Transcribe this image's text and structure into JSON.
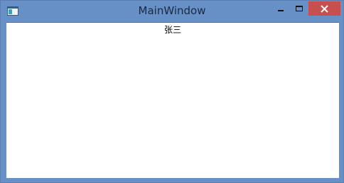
{
  "window": {
    "title": "MainWindow",
    "icons": {
      "app": "app-window-icon",
      "minimize": "minimize-icon",
      "maximize": "maximize-icon",
      "close": "close-icon"
    },
    "colors": {
      "frame": "#6690c6",
      "close_button": "#c7504f",
      "client": "#ffffff"
    }
  },
  "content": {
    "label": "张三"
  }
}
